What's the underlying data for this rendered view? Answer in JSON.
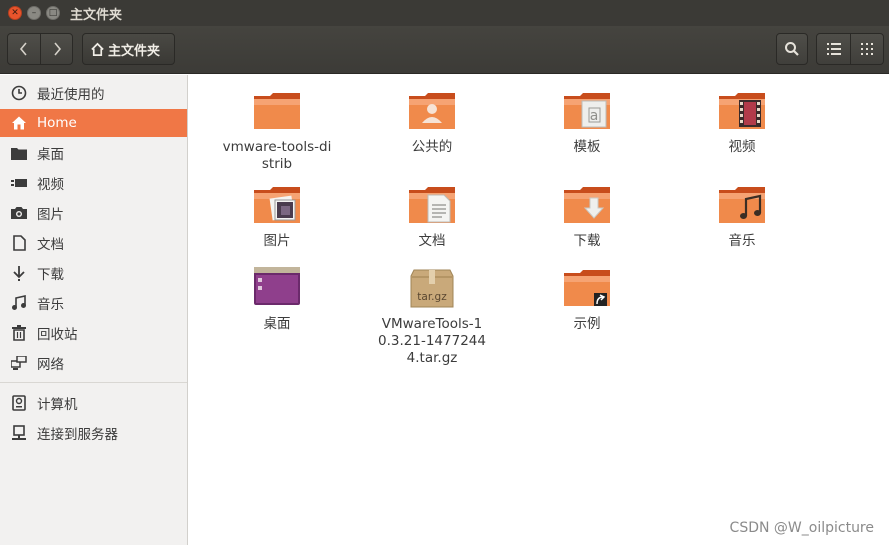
{
  "window": {
    "title": "主文件夹"
  },
  "toolbar": {
    "breadcrumb": "主文件夹"
  },
  "sidebar": {
    "items": [
      {
        "label": "最近使用的",
        "icon": "clock-icon"
      },
      {
        "label": "Home",
        "icon": "home-icon",
        "active": true
      },
      {
        "label": "桌面",
        "icon": "folder-icon"
      },
      {
        "label": "视频",
        "icon": "video-icon"
      },
      {
        "label": "图片",
        "icon": "camera-icon"
      },
      {
        "label": "文档",
        "icon": "document-icon"
      },
      {
        "label": "下载",
        "icon": "download-icon"
      },
      {
        "label": "音乐",
        "icon": "music-icon"
      },
      {
        "label": "回收站",
        "icon": "trash-icon"
      },
      {
        "label": "网络",
        "icon": "network-icon"
      },
      {
        "label": "计算机",
        "icon": "computer-icon"
      },
      {
        "label": "连接到服务器",
        "icon": "server-icon"
      }
    ]
  },
  "files": [
    {
      "name": "vmware-tools-distrib",
      "icon": "folder-icon"
    },
    {
      "name": "公共的",
      "icon": "folder-public-icon"
    },
    {
      "name": "模板",
      "icon": "folder-templates-icon"
    },
    {
      "name": "视频",
      "icon": "folder-videos-icon"
    },
    {
      "name": "图片",
      "icon": "folder-pictures-icon"
    },
    {
      "name": "文档",
      "icon": "folder-documents-icon"
    },
    {
      "name": "下载",
      "icon": "folder-download-icon"
    },
    {
      "name": "音乐",
      "icon": "folder-music-icon"
    },
    {
      "name": "桌面",
      "icon": "folder-desktop-icon"
    },
    {
      "name": "VMwareTools-10.3.21-14772444.tar.gz",
      "icon": "archive-icon"
    },
    {
      "name": "示例",
      "icon": "folder-link-icon"
    }
  ],
  "watermark": "CSDN @W_oilpicture",
  "colors": {
    "accent": "#f07746",
    "titlebar": "#3b3a36",
    "folder": "#e8672f"
  }
}
